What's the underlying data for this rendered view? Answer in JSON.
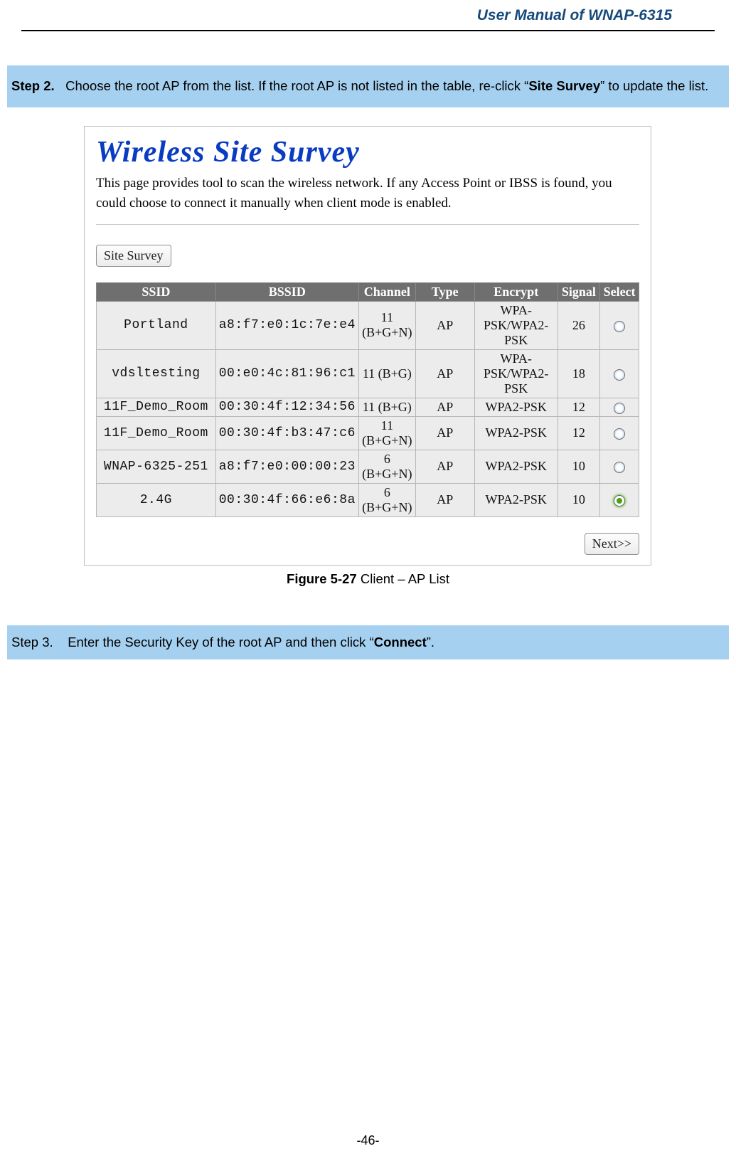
{
  "doc_header": "User Manual of WNAP-6315",
  "step2": {
    "label": "Step 2.",
    "text_before": "Choose the root AP from the list. If the root AP is not listed in the table, re-click “",
    "bold": "Site Survey",
    "text_after": "” to update the list."
  },
  "survey": {
    "title": "Wireless Site Survey",
    "description": "This page provides tool to scan the wireless network. If any Access Point or IBSS is found, you could choose to connect it manually when client mode is enabled.",
    "site_survey_btn": "Site Survey",
    "next_btn": "Next>>",
    "columns": [
      "SSID",
      "BSSID",
      "Channel",
      "Type",
      "Encrypt",
      "Signal",
      "Select"
    ],
    "rows": [
      {
        "ssid": "Portland",
        "bssid": "a8:f7:e0:1c:7e:e4",
        "channel": "11 (B+G+N)",
        "type": "AP",
        "encrypt": "WPA-PSK/WPA2-PSK",
        "signal": "26",
        "selected": false
      },
      {
        "ssid": "vdsltesting",
        "bssid": "00:e0:4c:81:96:c1",
        "channel": "11 (B+G)",
        "type": "AP",
        "encrypt": "WPA-PSK/WPA2-PSK",
        "signal": "18",
        "selected": false
      },
      {
        "ssid": "11F_Demo_Room",
        "bssid": "00:30:4f:12:34:56",
        "channel": "11 (B+G)",
        "type": "AP",
        "encrypt": "WPA2-PSK",
        "signal": "12",
        "selected": false
      },
      {
        "ssid": "11F_Demo_Room",
        "bssid": "00:30:4f:b3:47:c6",
        "channel": "11 (B+G+N)",
        "type": "AP",
        "encrypt": "WPA2-PSK",
        "signal": "12",
        "selected": false
      },
      {
        "ssid": "WNAP-6325-251",
        "bssid": "a8:f7:e0:00:00:23",
        "channel": "6 (B+G+N)",
        "type": "AP",
        "encrypt": "WPA2-PSK",
        "signal": "10",
        "selected": false
      },
      {
        "ssid": "2.4G",
        "bssid": "00:30:4f:66:e6:8a",
        "channel": "6 (B+G+N)",
        "type": "AP",
        "encrypt": "WPA2-PSK",
        "signal": "10",
        "selected": true
      }
    ]
  },
  "figure": {
    "label": "Figure 5-27",
    "caption": " Client – AP List"
  },
  "step3": {
    "label": "Step 3.",
    "text_before": "Enter the Security Key of the root AP and then click “",
    "bold": "Connect",
    "text_after": "”."
  },
  "page_number": "-46-"
}
